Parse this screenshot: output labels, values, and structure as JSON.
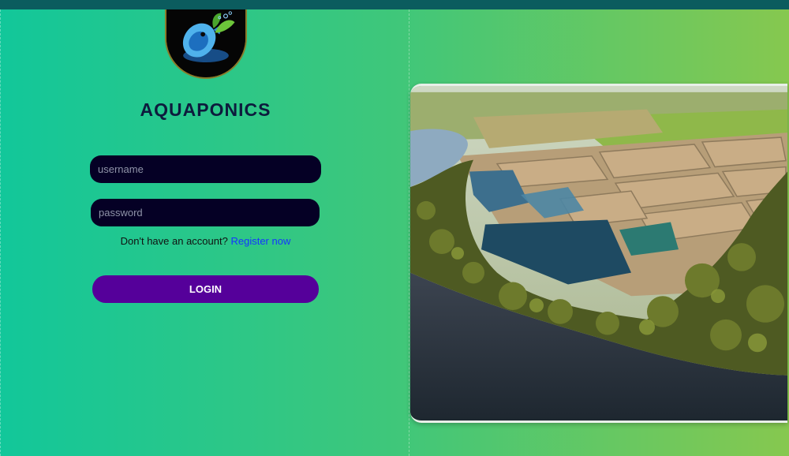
{
  "app": {
    "title": "AQUAPONICS"
  },
  "login_form": {
    "username_placeholder": "username",
    "password_placeholder": "password",
    "register_prompt": "Don't have an account?",
    "register_link": "Register now",
    "login_label": "LOGIN"
  },
  "colors": {
    "top_bar": "#0b5c5e",
    "gradient_start": "#12c79a",
    "gradient_end": "#86c84f",
    "input_background": "#050025",
    "login_button": "#55009a",
    "link": "#1535ff"
  },
  "icons": {
    "logo": "fish-leaf-logo-icon"
  }
}
